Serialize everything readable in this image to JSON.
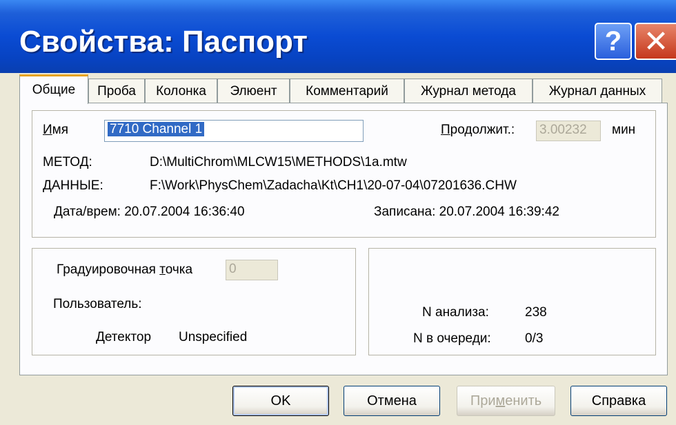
{
  "window": {
    "title": "Свойства: Паспорт",
    "help_glyph": "?",
    "close_glyph": "✕"
  },
  "tabs": [
    {
      "label": "Общие",
      "active": true
    },
    {
      "label": "Проба"
    },
    {
      "label": "Колонка"
    },
    {
      "label": "Элюент"
    },
    {
      "label": "Комментарий"
    },
    {
      "label": "Журнал метода"
    },
    {
      "label": "Журнал данных"
    }
  ],
  "general": {
    "name_label_u": "И",
    "name_label_rest": "мя",
    "name_value": "7710 Channel 1",
    "duration_label_u": "П",
    "duration_label_rest": "родолжит.:",
    "duration_value": "3.00232",
    "duration_unit": "мин",
    "method_label": "МЕТОД:",
    "method_value": "D:\\MultiChrom\\MLCW15\\METHODS\\1a.mtw",
    "data_label": "ДАННЫЕ:",
    "data_value": "F:\\Work\\PhysChem\\Zadacha\\Kt\\CH1\\20-07-04\\07201636.CHW",
    "datetime_text": "Дата/врем: 20.07.2004 16:36:40",
    "recorded_text": "Записана: 20.07.2004 16:39:42"
  },
  "calibration": {
    "point_label_a": "Градуировочная ",
    "point_label_u": "т",
    "point_label_b": "очка",
    "point_value": "0",
    "user_label": "Пользователь:",
    "detector_label": "Детектор",
    "detector_value": "Unspecified"
  },
  "analysis": {
    "n_analysis_label": "N анализа:",
    "n_analysis_value": "238",
    "n_queue_label": "N в очереди:",
    "n_queue_value": "0/3"
  },
  "buttons": {
    "ok": "OK",
    "cancel": "Отмена",
    "apply_a": "При",
    "apply_u": "м",
    "apply_b": "енить",
    "help": "Справка"
  },
  "colors": {
    "title_bar": "#0a4bd3",
    "active_tab_accent": "#e6a21a",
    "selection": "#316ac5",
    "close_button": "#c5381c"
  }
}
